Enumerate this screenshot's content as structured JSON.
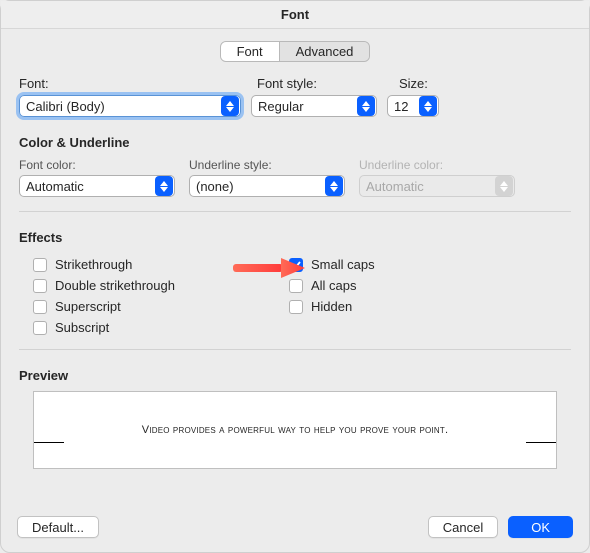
{
  "title": "Font",
  "tabs": {
    "font": "Font",
    "advanced": "Advanced"
  },
  "labels": {
    "font": "Font:",
    "style": "Font style:",
    "size": "Size:",
    "colorUnderline": "Color & Underline",
    "fontColor": "Font color:",
    "underlineStyle": "Underline style:",
    "underlineColor": "Underline color:",
    "effects": "Effects",
    "preview": "Preview"
  },
  "values": {
    "font": "Calibri (Body)",
    "style": "Regular",
    "size": "12",
    "fontColor": "Automatic",
    "underlineStyle": "(none)",
    "underlineColor": "Automatic"
  },
  "effects": {
    "strikethrough": "Strikethrough",
    "doubleStrike": "Double strikethrough",
    "superscript": "Superscript",
    "subscript": "Subscript",
    "smallCaps": "Small caps",
    "allCaps": "All caps",
    "hidden": "Hidden"
  },
  "preview_text": "Video provides a powerful way to help you prove your point.",
  "buttons": {
    "default": "Default...",
    "cancel": "Cancel",
    "ok": "OK"
  }
}
